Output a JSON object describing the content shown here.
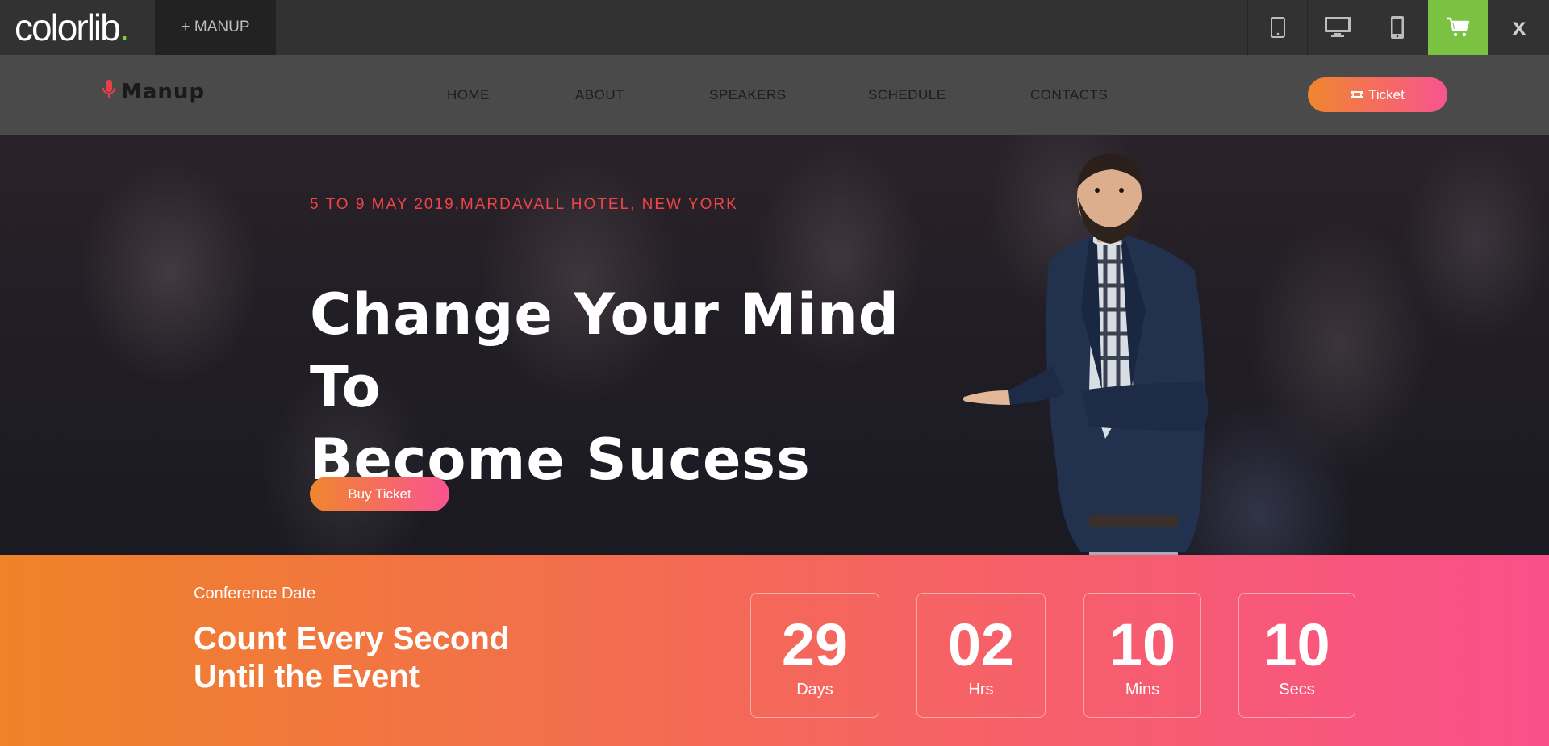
{
  "preview_bar": {
    "brand": "colorlib",
    "brand_dot": ".",
    "product_tab": "+ MANUP",
    "tools": [
      "tablet-icon",
      "desktop-icon",
      "mobile-icon",
      "cart-icon"
    ],
    "close": "x",
    "cart_color": "#7cc242"
  },
  "header": {
    "logo": "Manup",
    "logo_icon": "microphone-icon",
    "nav": [
      "HOME",
      "ABOUT",
      "SPEAKERS",
      "SCHEDULE",
      "CONTACTS"
    ],
    "ticket_button": "Ticket",
    "ticket_icon": "ticket-icon"
  },
  "hero": {
    "date_location": "5 TO 9 MAY 2019,MARDAVALL HOTEL, NEW YORK",
    "title_line1": "Change Your Mind To",
    "title_line2": "Become Sucess",
    "buy_button": "Buy Ticket",
    "accent_color": "#f2434b"
  },
  "countdown": {
    "label": "Conference Date",
    "title_line1": "Count Every Second",
    "title_line2": "Until the Event",
    "items": [
      {
        "value": "29",
        "unit": "Days"
      },
      {
        "value": "02",
        "unit": "Hrs"
      },
      {
        "value": "10",
        "unit": "Mins"
      },
      {
        "value": "10",
        "unit": "Secs"
      }
    ],
    "gradient": [
      "#ef8328",
      "#f9508a"
    ]
  }
}
